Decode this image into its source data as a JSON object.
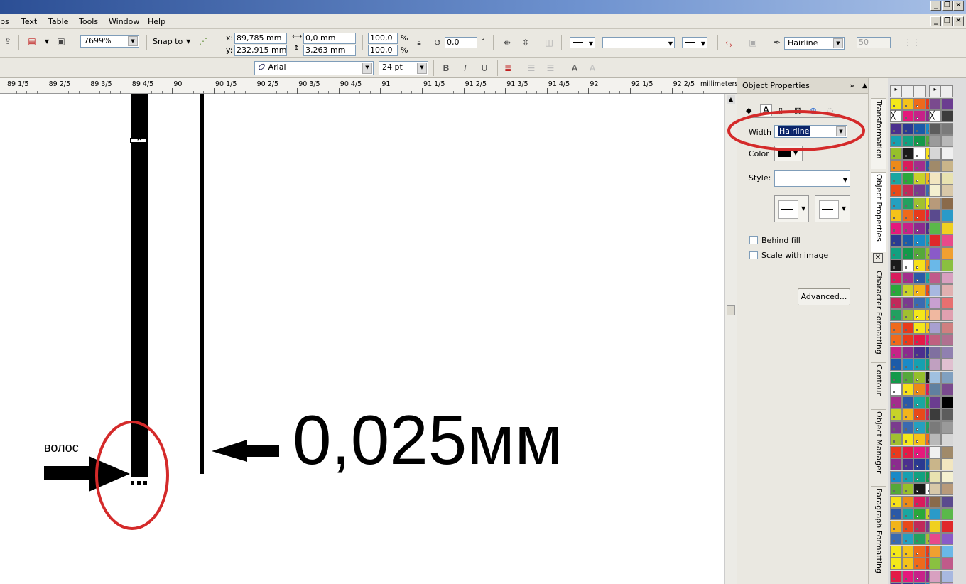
{
  "menubar": {
    "items": [
      "ps",
      "Text",
      "Table",
      "Tools",
      "Window",
      "Help"
    ]
  },
  "propbar": {
    "zoom": "7699%",
    "snap_to": "Snap to",
    "x_label": "x:",
    "y_label": "y:",
    "x": "89,785 mm",
    "y": "232,915 mm",
    "w": "0,0 mm",
    "h": "3,263 mm",
    "scale_w": "100,0",
    "scale_h": "100,0",
    "pct_w": "%",
    "pct_h": "%",
    "rotation": "0,0",
    "rotation_unit": "°",
    "outline_width": "Hairline",
    "outline_size": "50"
  },
  "textbar": {
    "font": "Arial",
    "size": "24 pt"
  },
  "ruler": {
    "units": "millimeters",
    "labels": [
      "89  1/5",
      "89  2/5",
      "89  3/5",
      "89  4/5",
      "90",
      "90  1/5",
      "90  2/5",
      "90  3/5",
      "90  4/5",
      "91",
      "91  1/5",
      "91  2/5",
      "91  3/5",
      "91  4/5",
      "92",
      "92  1/5",
      "92  2/5"
    ]
  },
  "canvas": {
    "hair_label": "волос",
    "measure_label": "0,025мм"
  },
  "docker": {
    "title": "Object Properties",
    "width_label": "Width",
    "width_value": "Hairline",
    "color_label": "Color",
    "style_label": "Style:",
    "behind_fill": "Behind fill",
    "scale_with_image": "Scale with image",
    "advanced": "Advanced..."
  },
  "tabs": [
    "Transformation",
    "Object Properties",
    "Character Formatting",
    "Contour",
    "Object Manager",
    "Paragraph Formatting"
  ],
  "colors": {
    "highlight": "#d42a2a",
    "titlebar": "#2c4f95",
    "selection": "#0a246a"
  },
  "palette": {
    "left": [
      "#f4e81a",
      "#f5c21a",
      "#ef6a1b",
      "#e83a1c",
      "#e31b47",
      "#e5197c",
      "#c72288",
      "#8b2b8e",
      "#4b2f8e",
      "#2b3a91",
      "#1b5ba8",
      "#1b8ac7",
      "#16a0b0",
      "#12a080",
      "#13994a",
      "#55a83a",
      "#96bf2b",
      "#1a1a1a",
      "#ffffff",
      "#f7e01a",
      "#eb8a1a",
      "#d91c5c",
      "#a32d8c",
      "#2b59a6",
      "#1aa6a1",
      "#2aa83a",
      "#c7d22a",
      "#f2b41a",
      "#e84a1a",
      "#c02a5a",
      "#7a3b8e",
      "#3a6ab0",
      "#25a0c0",
      "#22a060",
      "#a0c030",
      "#f4e81a",
      "#f5c21a",
      "#ef6a1b",
      "#e83a1c",
      "#e31b47",
      "#e5197c",
      "#c72288",
      "#8b2b8e",
      "#4b2f8e",
      "#2b3a91",
      "#1b5ba8",
      "#1b8ac7",
      "#16a0b0",
      "#12a080",
      "#13994a",
      "#55a83a",
      "#96bf2b",
      "#1a1a1a",
      "#ffffff",
      "#f7e01a",
      "#eb8a1a",
      "#d91c5c",
      "#a32d8c",
      "#2b59a6",
      "#1aa6a1",
      "#2aa83a",
      "#c7d22a",
      "#f2b41a",
      "#e84a1a",
      "#c02a5a",
      "#7a3b8e",
      "#3a6ab0",
      "#25a0c0",
      "#22a060",
      "#a0c030",
      "#f4e81a",
      "#f5c21a",
      "#ef6a1b",
      "#e83a1c"
    ],
    "right": [
      "#7a4a8e",
      "#6b3d90",
      "#000000",
      "#3c3c3c",
      "#5c5c5c",
      "#7a7a7a",
      "#9a9a9a",
      "#b8b8b8",
      "#d6d6d6",
      "#f0f0f0",
      "#a08a6a",
      "#c9b58a",
      "#f2e6c0",
      "#e8e2b0",
      "#f4f0d0",
      "#d8c8a8",
      "#b89a7a",
      "#8a6a4a",
      "#5a4a8e",
      "#2a9ac8",
      "#5ab84a",
      "#f0d020",
      "#e0282a",
      "#e84a8a",
      "#8a5ac8",
      "#f0a030",
      "#6ab8e8",
      "#8ac040",
      "#c05a8a",
      "#d8a0c0",
      "#a8b8e0",
      "#e0b0b0",
      "#c8a0d0",
      "#e87070",
      "#f0b8a0",
      "#e0a0b0",
      "#a8a0d0",
      "#d08080",
      "#c06080",
      "#b07090",
      "#8070a0",
      "#9080b0",
      "#c0a0c0",
      "#e0c0d0",
      "#a0c0e0",
      "#80a0c0",
      "#6080a0"
    ]
  }
}
